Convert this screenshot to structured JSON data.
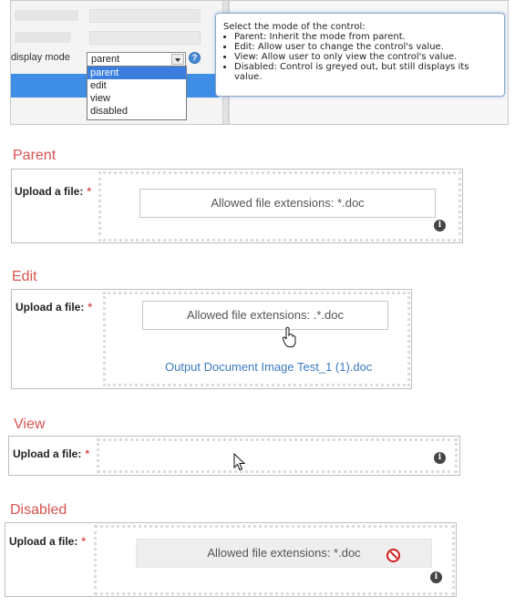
{
  "top": {
    "display_mode_label": "display mode",
    "selected": "parent",
    "options": [
      "parent",
      "edit",
      "view",
      "disabled"
    ],
    "help": "?",
    "tooltip": {
      "intro": "Select the mode of the control:",
      "items": [
        "Parent: Inherit the mode from parent.",
        "Edit: Allow user to change the control's value.",
        "View: Allow user to only view the control's value.",
        "Disabled: Control is greyed out, but still displays its value."
      ]
    }
  },
  "sections": {
    "parent": {
      "title": "Parent",
      "label": "Upload a file:",
      "required": "*",
      "file_text": "Allowed file extensions: *.doc",
      "info": "i"
    },
    "edit": {
      "title": "Edit",
      "label": "Upload a file:",
      "required": "*",
      "file_text": "Allowed file extensions: .*.doc",
      "link": "Output Document Image Test_1 (1).doc"
    },
    "view": {
      "title": "View",
      "label": "Upload a file:",
      "required": "*",
      "info": "i"
    },
    "disabled": {
      "title": "Disabled",
      "label": "Upload a file:",
      "required": "*",
      "file_text": "Allowed file extensions: *.doc",
      "info": "i"
    }
  },
  "colors": {
    "title_red": "#d9534f",
    "link_blue": "#3a7abf",
    "select_blue": "#3a7ee0"
  }
}
